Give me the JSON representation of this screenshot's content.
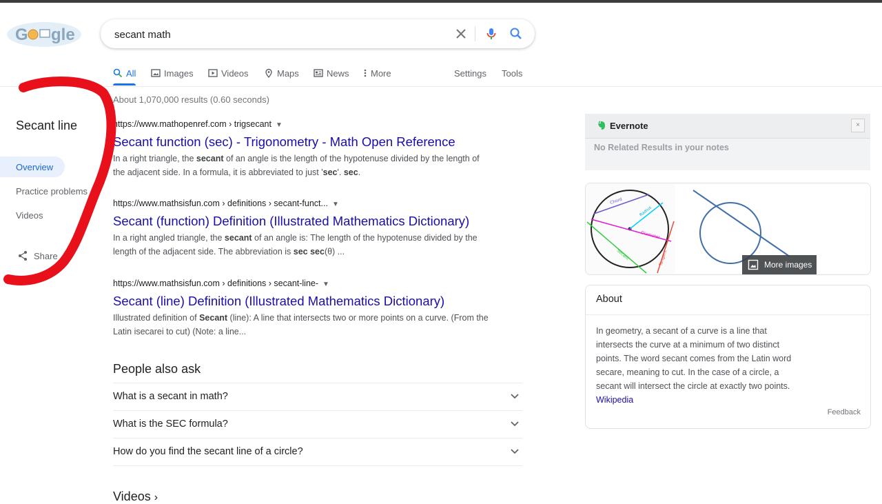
{
  "search": {
    "query": "secant math"
  },
  "tabs": [
    {
      "label": "All",
      "icon": "search-icon"
    },
    {
      "label": "Images",
      "icon": "image-icon"
    },
    {
      "label": "Videos",
      "icon": "video-icon"
    },
    {
      "label": "Maps",
      "icon": "map-pin-icon"
    },
    {
      "label": "News",
      "icon": "news-icon"
    },
    {
      "label": "More",
      "icon": "more-dots-icon"
    }
  ],
  "tools": {
    "settings": "Settings",
    "tools": "Tools"
  },
  "left_panel": {
    "title": "Secant line",
    "items": [
      "Overview",
      "Practice problems",
      "Videos"
    ],
    "share": "Share"
  },
  "stats": "About 1,070,000 results (0.60 seconds)",
  "results": [
    {
      "url": "https://www.mathopenref.com › trigsecant",
      "title": "Secant function (sec) - Trigonometry - Math Open Reference",
      "snippet_parts": [
        "In a right triangle, the ",
        "secant",
        " of an angle is the length of the hypotenuse divided by the length of the adjacent side. In a formula, it is abbreviated to just '",
        "sec",
        "'. ",
        "sec",
        "."
      ]
    },
    {
      "url": "https://www.mathsisfun.com › definitions › secant-funct...",
      "title": "Secant (function) Definition (Illustrated Mathematics Dictionary)",
      "snippet_parts": [
        "In a right angled triangle, the ",
        "secant",
        " of an angle is: The length of the hypotenuse divided by the length of the adjacent side. The abbreviation is ",
        "sec sec",
        "(θ) ..."
      ]
    },
    {
      "url": "https://www.mathsisfun.com › definitions › secant-line-",
      "title": "Secant (line) Definition (Illustrated Mathematics Dictionary)",
      "snippet_parts": [
        "Illustrated definition of ",
        "Secant",
        " (line): A line that intersects two or more points on a curve. (From the Latin isecarei to cut) (Note: a line..."
      ]
    }
  ],
  "people_also_ask": {
    "title": "People also ask",
    "questions": [
      "What is a secant in math?",
      "What is the SEC formula?",
      "How do you find the secant line of a circle?"
    ]
  },
  "videos_heading": "Videos",
  "evernote": {
    "name": "Evernote",
    "close": "×",
    "message": "No Related Results in your notes"
  },
  "images": {
    "more_label": "More images",
    "diagram_labels": [
      "Chord",
      "Radius",
      "Diameter",
      "Secant",
      "Tangent"
    ]
  },
  "about": {
    "title": "About",
    "text": "In geometry, a secant of a curve is a line that intersects the curve at a minimum of two distinct points. The word secant comes from the Latin word secare, meaning to cut. In the case of a circle, a secant will intersect the circle at exactly two points.",
    "source": "Wikipedia",
    "feedback": "Feedback"
  },
  "colors": {
    "link": "#1a0dab",
    "accent": "#1a73e8",
    "annotation": "#e8111b"
  }
}
